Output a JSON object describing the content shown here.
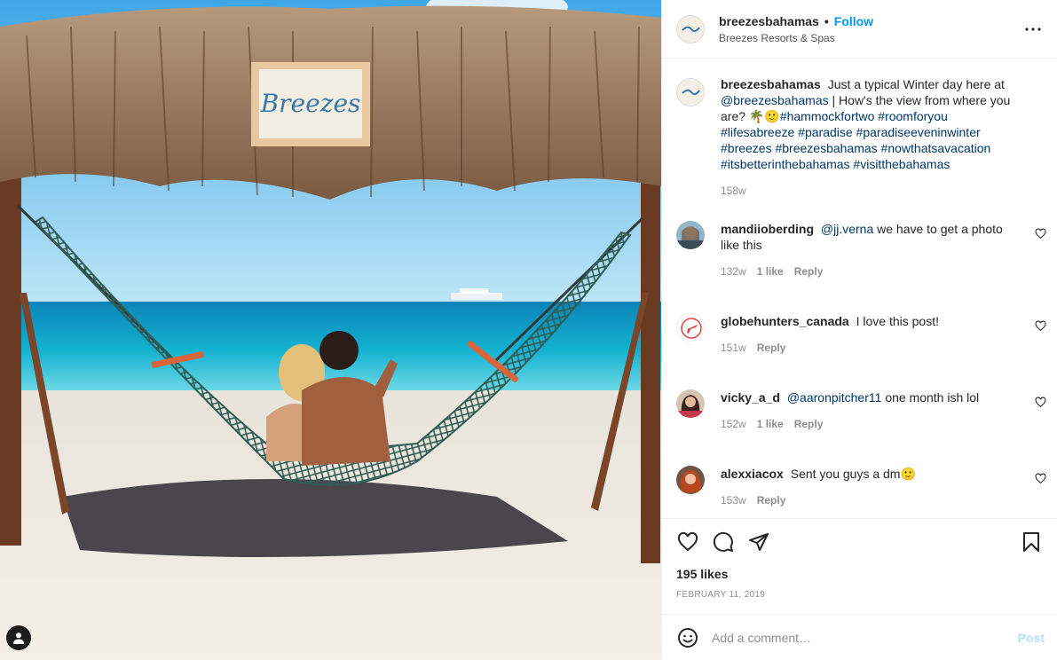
{
  "post": {
    "username": "breezesbahamas",
    "follow_label": "Follow",
    "location": "Breezes Resorts & Spas",
    "sign_text": "Breezes"
  },
  "caption": {
    "username": "breezesbahamas",
    "text_1": "Just a typical Winter day here at",
    "mention": "@breezesbahamas",
    "text_2": "| How's the view from where you are?",
    "emoji": "🌴🙂",
    "hashtags_line1": "#hammockfortwo #roomforyou #lifesabreeze",
    "hashtags_line2": "#paradise #paradiseeveninwinter #breezes",
    "hashtags_line3": "#breezesbahamas #nowthatsavacation",
    "hashtags_line4": "#itsbetterinthebahamas #visitthebahamas",
    "time": "158w"
  },
  "comments": [
    {
      "username": "mandiioberding",
      "mention": "@jj.verna",
      "text": "we have to get a photo like this",
      "time": "132w",
      "likes": "1 like",
      "reply": "Reply"
    },
    {
      "username": "globehunters_canada",
      "mention": "",
      "text": "I love this post!",
      "time": "151w",
      "likes": "",
      "reply": "Reply"
    },
    {
      "username": "vicky_a_d",
      "mention": "@aaronpitcher11",
      "text": "one month ish lol",
      "time": "152w",
      "likes": "1 like",
      "reply": "Reply"
    },
    {
      "username": "alexxiacox",
      "mention": "",
      "text": "Sent you guys a dm🙂",
      "time": "153w",
      "likes": "",
      "reply": "Reply"
    }
  ],
  "stats": {
    "likes": "195 likes",
    "date": "FEBRUARY 11, 2019"
  },
  "composer": {
    "placeholder": "Add a comment…",
    "post_label": "Post"
  },
  "icons": {
    "like": "heart-icon",
    "comment": "comment-icon",
    "share": "send-icon",
    "save": "bookmark-icon",
    "more": "more-icon",
    "emoji": "emoji-icon",
    "tag": "user-tag-icon"
  },
  "colors": {
    "accent": "#0095f6",
    "link": "#00376b",
    "muted": "#8e8e8e",
    "post_disabled": "#b2dffc"
  }
}
